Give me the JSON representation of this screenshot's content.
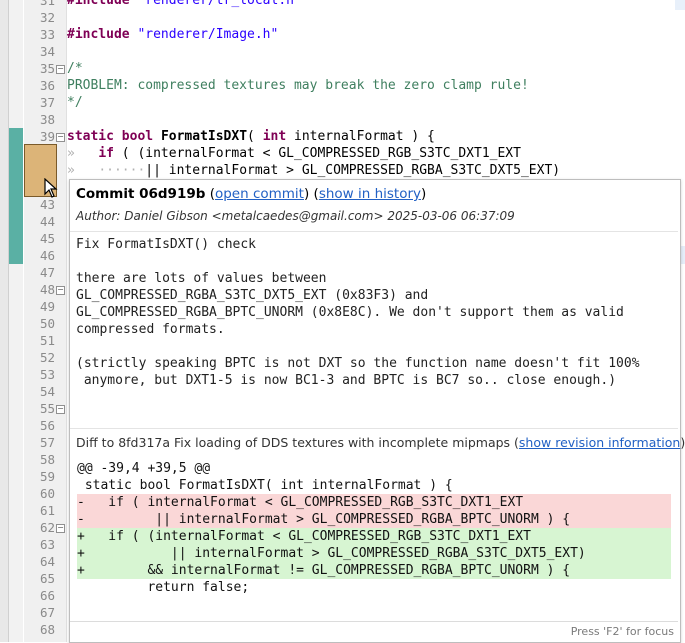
{
  "editor": {
    "lines_top": [
      {
        "num": "31",
        "code": "#include \"renderer/tr_local.h\""
      },
      {
        "num": "32",
        "code": ""
      },
      {
        "num": "33",
        "code": "#include \"renderer/Image.h\""
      },
      {
        "num": "34",
        "code": ""
      },
      {
        "num": "35",
        "code": "/*"
      },
      {
        "num": "36",
        "code": "PROBLEM: compressed textures may break the zero clamp rule!"
      },
      {
        "num": "37",
        "code": "*/"
      },
      {
        "num": "38",
        "code": ""
      },
      {
        "num": "39",
        "code": "static bool FormatIsDXT( int internalFormat ) {"
      },
      {
        "num": "40",
        "code": "»   if ( (internalFormat < GL_COMPRESSED_RGB_S3TC_DXT1_EXT"
      },
      {
        "num": "41",
        "code": "»   ······|| internalFormat > GL_COMPRESSED_RGBA_S3TC_DXT5_EXT)"
      }
    ],
    "gutter_numbers": [
      "42",
      "43",
      "44",
      "45",
      "46",
      "47",
      "48",
      "49",
      "50",
      "51",
      "52",
      "53",
      "54",
      "55",
      "56",
      "57",
      "58",
      "59",
      "60",
      "61",
      "62",
      "63",
      "64",
      "65",
      "66",
      "67",
      "68"
    ]
  },
  "popup": {
    "commit_label": "Commit",
    "commit_hash": "06d919b",
    "open_commit": "open commit",
    "show_in_history": "show in history",
    "author_line": "Author: Daniel Gibson <metalcaedes@gmail.com> 2025-03-06 06:37:09",
    "message": "Fix FormatIsDXT() check\n\nthere are lots of values between\nGL_COMPRESSED_RGBA_S3TC_DXT5_EXT (0x83F3) and\nGL_COMPRESSED_RGBA_BPTC_UNORM (0x8E8C). We don't support them as valid\ncompressed formats.\n\n(strictly speaking BPTC is not DXT so the function name doesn't fit 100%\n anymore, but DXT1-5 is now BC1-3 and BPTC is BC7 so.. close enough.)",
    "diff_header": "Diff to 8fd317a Fix loading of DDS textures with incomplete mipmaps",
    "show_revision": "show revision information",
    "diff_lines": [
      {
        "type": "ctx",
        "text": "@@ -39,4 +39,5 @@"
      },
      {
        "type": "ctx",
        "text": " static bool FormatIsDXT( int internalFormat ) {"
      },
      {
        "type": "del",
        "text": "-   if ( internalFormat < GL_COMPRESSED_RGB_S3TC_DXT1_EXT"
      },
      {
        "type": "del",
        "text": "-         || internalFormat > GL_COMPRESSED_RGBA_BPTC_UNORM ) {"
      },
      {
        "type": "add",
        "text": "+   if ( (internalFormat < GL_COMPRESSED_RGB_S3TC_DXT1_EXT"
      },
      {
        "type": "add",
        "text": "+           || internalFormat > GL_COMPRESSED_RGBA_S3TC_DXT5_EXT)"
      },
      {
        "type": "add",
        "text": "+        && internalFormat != GL_COMPRESSED_RGBA_BPTC_UNORM ) {"
      },
      {
        "type": "ctx",
        "text": "         return false;"
      }
    ],
    "focus_hint": "Press 'F2' for focus"
  },
  "colors": {
    "blame_highlight": "#dcc498",
    "keyword": "#7f0055",
    "string": "#2a00ff",
    "comment": "#3f7f5f",
    "diff_removed": "#fad7d7",
    "diff_added": "#d7f5d2",
    "link": "#2160c4"
  }
}
